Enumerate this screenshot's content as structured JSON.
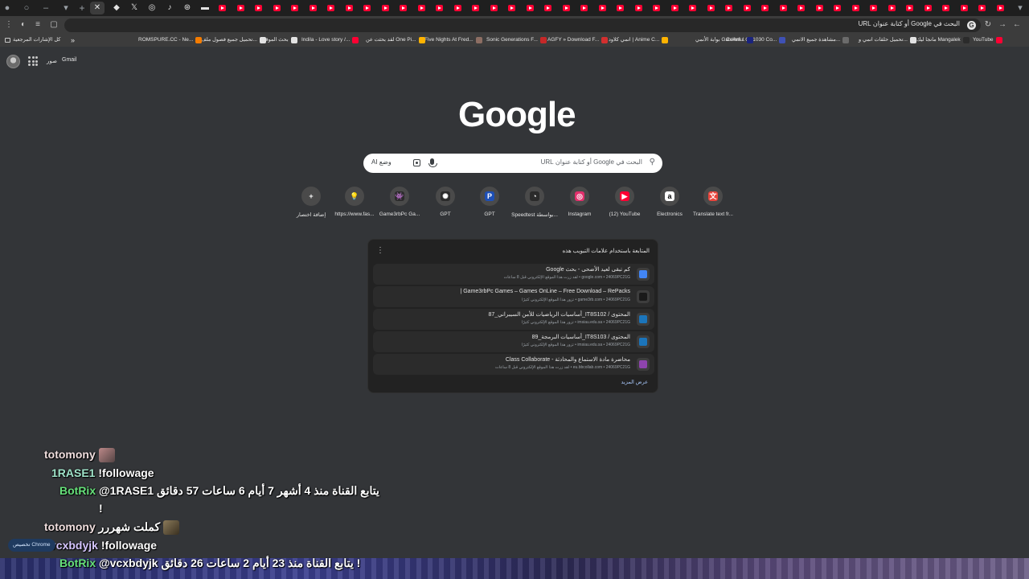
{
  "omnibox": {
    "text": "البحث في Google أو كتابة عنوان URL"
  },
  "bookmarks": [
    {
      "label": "YouTube",
      "color": "#ff0033"
    },
    {
      "label": "مانجا ليك Mangalek",
      "color": "#2b2b2b"
    },
    {
      "label": "تحميل حلقات انمي و...",
      "color": "#e3e3e3"
    },
    {
      "label": "مشاهدة جميع الانمي...",
      "color": "#6b6b6b"
    },
    {
      "label": "Colorful GT1030 Co...",
      "color": "#3f51b5"
    },
    {
      "label": "بوابة الأنمي GateAni...",
      "color": "#1a237e"
    },
    {
      "label": "انمي كلاود | Anime C...",
      "color": "#ffb300"
    },
    {
      "label": "AGFY » Download F...",
      "color": "#d32f2f"
    },
    {
      "label": "Sonic Generations F...",
      "color": "#c62828"
    },
    {
      "label": "Five Nights At Fred...",
      "color": "#8d6e63"
    },
    {
      "label": "لقد بحثت عن One Pi...",
      "color": "#ffb300"
    },
    {
      "label": "Indila - Love story /...",
      "color": "#ff0033"
    },
    {
      "label": "بحث الموقع",
      "color": "#e3e3e3"
    },
    {
      "label": "تحميل جميع فصول ملف...",
      "color": "#e3e3e3"
    },
    {
      "label": "ROMSPURE.CC - Ne...",
      "color": "#f57c00"
    }
  ],
  "bookmarks_all": "كل الإشارات المرجعية",
  "bookmarks_overflow": "»",
  "header": {
    "gmail": "Gmail",
    "images": "صور"
  },
  "logo": "Google",
  "search": {
    "placeholder": "البحث في Google أو كتابة عنوان URL",
    "ai_mode": "AI وضع"
  },
  "shortcuts": [
    {
      "label": "Translate text fr...",
      "icon": "translate-icon",
      "color": "#e8453c",
      "glyph": "文"
    },
    {
      "label": "Electronics",
      "icon": "amazon-icon",
      "color": "#ffffff",
      "glyph": "a"
    },
    {
      "label": "(12) YouTube",
      "icon": "youtube-icon",
      "color": "#ff0033",
      "glyph": "▶"
    },
    {
      "label": "Instagram",
      "icon": "instagram-icon",
      "color": "#e1306c",
      "glyph": "◎"
    },
    {
      "label": "Speedtest بواسطة...",
      "icon": "speedtest-icon",
      "color": "#2b2b2b",
      "glyph": "◔"
    },
    {
      "label": "GPT",
      "icon": "gpt-icon-blue",
      "color": "#1e4fb5",
      "glyph": "P"
    },
    {
      "label": "GPT",
      "icon": "gpt-icon",
      "color": "#2b2b2b",
      "glyph": "✺"
    },
    {
      "label": "Game3rbPc Ga...",
      "icon": "game3rb-icon",
      "color": "#2b2b2b",
      "glyph": "👾"
    },
    {
      "label": "https://www.fas...",
      "icon": "bulb-icon",
      "color": "#4a4a4a",
      "glyph": "💡"
    },
    {
      "label": "إضافة اختصار",
      "icon": "plus-icon",
      "color": "#4a4a4a",
      "glyph": "+"
    }
  ],
  "continue_card": {
    "title": "المتابعة باستخدام علامات التبويب هذه",
    "more": "عرض المزيد",
    "items": [
      {
        "title": "كم تبقى لعيد الأضحى - بحث Google",
        "meta": "google.com • 24069PC21G • لقد زرت هذا الموقع الإلكتروني قبل 8 ساعات",
        "color": "#4285f4"
      },
      {
        "title": "Game3rbPc Games – Games OnLine – Free Download – RePacks |",
        "meta": "game3rb.com • 24069PC21G • تزور هذا الموقع الإلكتروني كثيرًا",
        "color": "#1a1a1a"
      },
      {
        "title": "المحتوى / IT8S102_أساسيات الرياضيات للأمن السيبراني_87",
        "meta": "imsiau.edu.sa • 24069PC21G • تزور هذا الموقع الإلكتروني كثيرًا",
        "color": "#1b75bb"
      },
      {
        "title": "المحتوى / IT8S103_أساسيات البرمجة_89",
        "meta": "imsiau.edu.sa • 24069PC21G • تزور هذا الموقع الإلكتروني كثيرًا",
        "color": "#1b75bb"
      },
      {
        "title": "محاضرة مادة الاستماع والمحادثة - Class Collaborate",
        "meta": "eu.bbcollab.com • 24069PC21G • لقد زرت هذا الموقع الإلكتروني قبل 8 ساعات",
        "color": "#8e44ad"
      }
    ]
  },
  "chat": [
    {
      "user": "totomony",
      "text": ""
    },
    {
      "user": "1RASE1",
      "text": "!followage"
    },
    {
      "user": "BotRix",
      "text": "@1RASE1 يتابع القناة منذ 4 أشهر 7 أيام 6 ساعات 57 دقائق"
    },
    {
      "user": "",
      "text": "!"
    },
    {
      "user": "totomony",
      "text": "كملت شهررر"
    },
    {
      "user": "vcxbdyjk",
      "text": "!followage"
    },
    {
      "user": "BotRix",
      "text": "@vcxbdyjk يتابع القناة منذ 23 أيام 2 ساعات 26 دقائق !"
    }
  ],
  "customize": "تخصيص Chrome"
}
